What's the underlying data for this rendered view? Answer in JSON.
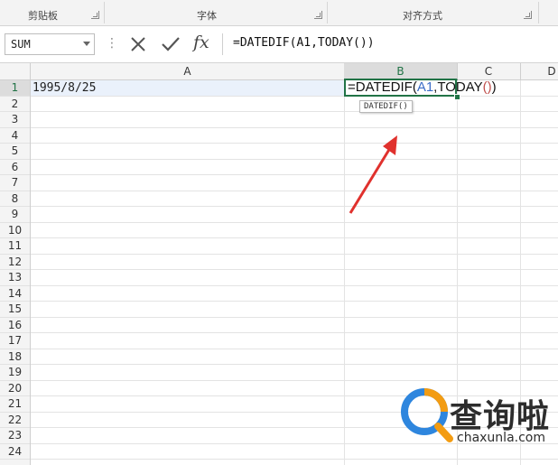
{
  "ribbon": {
    "groups": [
      {
        "label": "剪贴板"
      },
      {
        "label": "字体"
      },
      {
        "label": "对齐方式"
      }
    ]
  },
  "formula_bar": {
    "name_box": "SUM",
    "cancel_icon": "close-icon",
    "enter_icon": "check-icon",
    "function_icon": "fx-icon",
    "function_label": "fx",
    "formula": "=DATEDIF(A1,TODAY())"
  },
  "columns": [
    "A",
    "B",
    "C",
    "D"
  ],
  "active_column": "B",
  "rows": [
    "1",
    "2",
    "3",
    "4",
    "5",
    "6",
    "7",
    "8",
    "9",
    "10",
    "11",
    "12",
    "13",
    "14",
    "15",
    "16",
    "17",
    "18",
    "19",
    "20",
    "21",
    "22",
    "23",
    "24"
  ],
  "active_row": "1",
  "cells": {
    "a1": "1995/8/25",
    "b1": {
      "prefix": "=DATEDIF(",
      "ref": "A1",
      "middle": ",TODAY",
      "open_paren": "(",
      "close_paren": ")",
      "end": ")"
    }
  },
  "tooltip": "DATEDIF()",
  "colors": {
    "accent_green": "#217346",
    "reference_blue": "#3a6cc6",
    "paren_red": "#c0504d",
    "arrow_red": "#e0312d",
    "watermark_orange": "#f39c12",
    "watermark_blue": "#2e86de"
  },
  "watermark": {
    "text": "查询啦",
    "url": "chaxunla.com"
  }
}
